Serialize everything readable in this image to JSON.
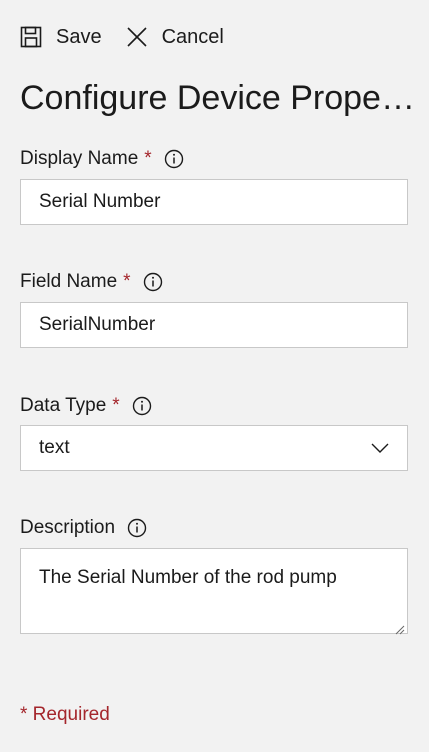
{
  "toolbar": {
    "save_label": "Save",
    "cancel_label": "Cancel"
  },
  "title": "Configure Device Properties",
  "fields": {
    "display_name": {
      "label": "Display Name",
      "required_mark": "*",
      "value": "Serial Number"
    },
    "field_name": {
      "label": "Field Name",
      "required_mark": "*",
      "value": "SerialNumber"
    },
    "data_type": {
      "label": "Data Type",
      "required_mark": "*",
      "selected": "text"
    },
    "description": {
      "label": "Description",
      "value": "The Serial Number of the rod pump"
    }
  },
  "footer": {
    "required_note": "* Required"
  },
  "colors": {
    "background": "#f2f2f2",
    "required": "#a4262c",
    "border": "#c8c8c8"
  },
  "icons": {
    "save": "save-icon",
    "cancel": "close-icon",
    "info": "info-icon",
    "dropdown": "chevron-down-icon"
  }
}
